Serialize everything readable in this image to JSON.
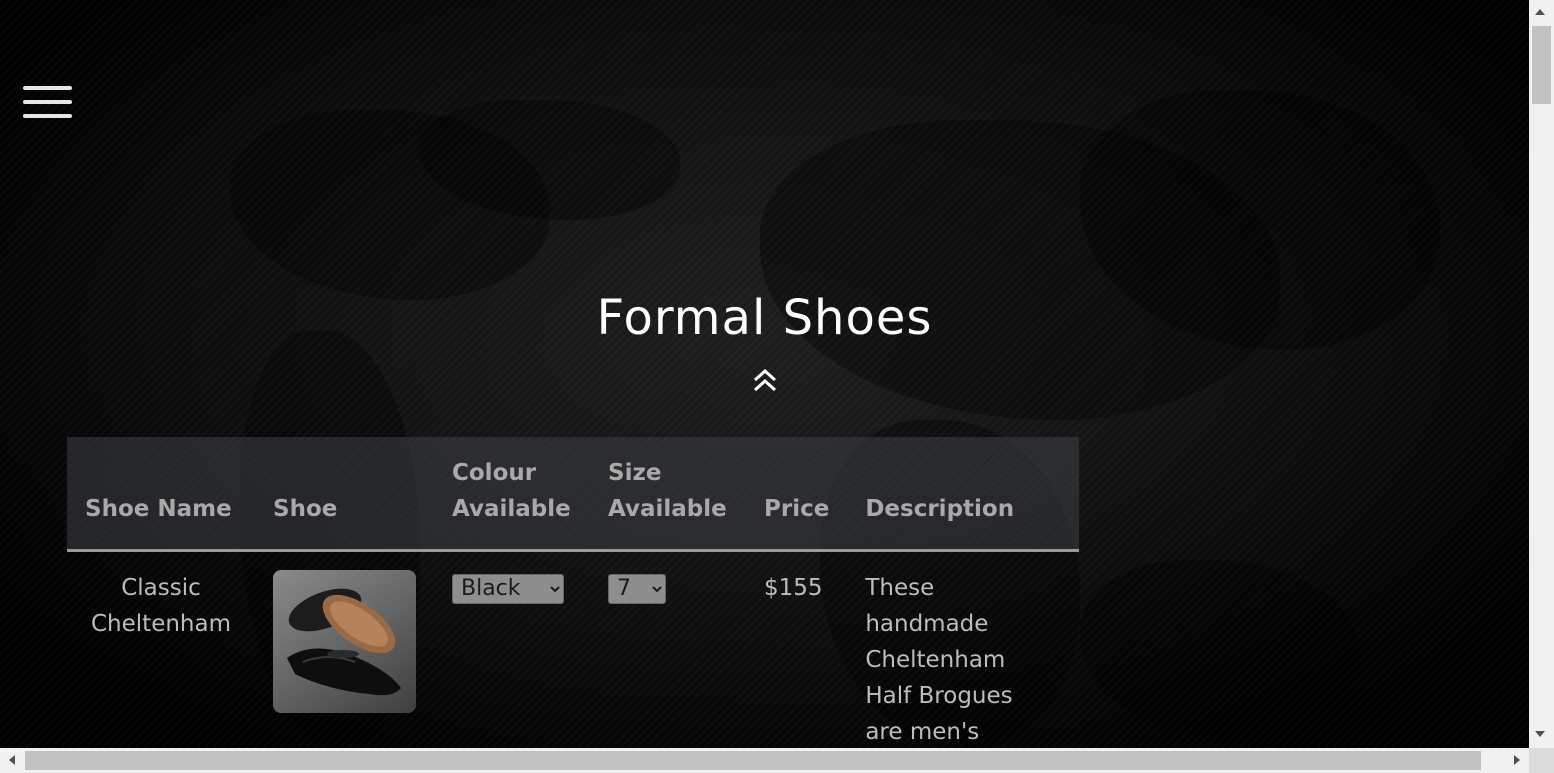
{
  "nav": {
    "menu_icon": "hamburger-icon"
  },
  "page": {
    "title": "Formal Shoes",
    "scroll_up_icon": "double-chevron-up-icon"
  },
  "table": {
    "headers": [
      "Shoe Name",
      "Shoe",
      "Colour Available",
      "Size Available",
      "Price",
      "Description"
    ],
    "rows": [
      {
        "name": "Classic Cheltenham",
        "image_icon": "black-oxford-shoe-image",
        "colour": "Black",
        "size": "7",
        "price": "$155",
        "description": "These handmade Cheltenham Half Brogues are men's"
      }
    ]
  },
  "colors": {
    "text": "#bdbdbd",
    "header_bg": "#3c4046",
    "title": "#ffffff"
  }
}
